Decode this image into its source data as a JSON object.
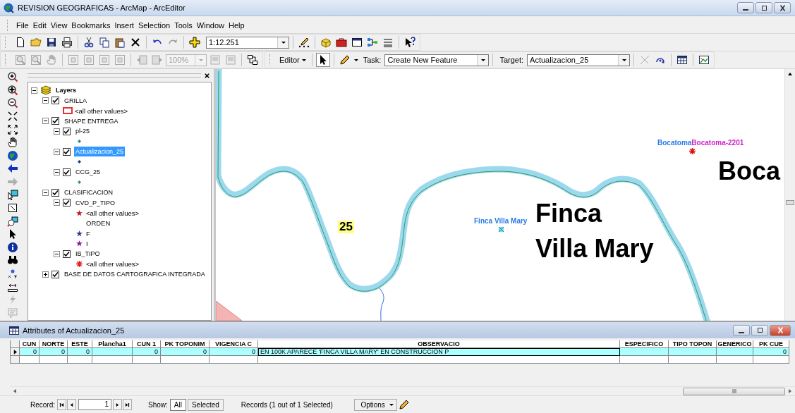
{
  "window": {
    "title": "REVISION GEOGRAFICAS - ArcMap - ArcEditor"
  },
  "menu": [
    "File",
    "Edit",
    "View",
    "Bookmarks",
    "Insert",
    "Selection",
    "Tools",
    "Window",
    "Help"
  ],
  "standard_toolbar": {
    "scale": "1:12.251"
  },
  "layout_toolbar": {
    "zoom": "100%",
    "zoom_disabled": true
  },
  "editor_toolbar": {
    "menu": "Editor",
    "task_label": "Task:",
    "task": "Create New Feature",
    "target_label": "Target:",
    "target": "Actualizacion_25"
  },
  "toc": {
    "root": {
      "label": "Layers",
      "expanded": true,
      "selected": false,
      "children": [
        {
          "label": "GRILLA",
          "checked": true,
          "expanded": true,
          "selected": false,
          "legend": [
            {
              "kind": "box",
              "color": "#e83030",
              "label": "<all other values>"
            }
          ]
        },
        {
          "label": "SHAPE ENTREGA",
          "checked": true,
          "expanded": true,
          "selected": false,
          "children": [
            {
              "label": "pl-25",
              "checked": true,
              "expanded": true,
              "selected": false,
              "legend": [
                {
                  "kind": "dot",
                  "color": "#1a8a8a"
                }
              ]
            },
            {
              "label": "Actualizacion_25",
              "checked": true,
              "expanded": true,
              "selected": true,
              "legend": [
                {
                  "kind": "dot",
                  "color": "#1a3a8a"
                }
              ]
            },
            {
              "label": "CCG_25",
              "checked": true,
              "expanded": true,
              "selected": false,
              "legend": [
                {
                  "kind": "dot",
                  "color": "#2a9a6a"
                }
              ]
            }
          ]
        },
        {
          "label": "CLASIFICACION",
          "checked": true,
          "expanded": true,
          "selected": false,
          "children": [
            {
              "label": "CVD_P_TIPO",
              "checked": true,
              "expanded": true,
              "selected": false,
              "legend": [
                {
                  "kind": "star",
                  "color": "#c01818",
                  "label": "<all other values>"
                },
                {
                  "kind": "heading",
                  "label": "ORDEN"
                },
                {
                  "kind": "star",
                  "color": "#2a3a8a",
                  "label": "F"
                },
                {
                  "kind": "star",
                  "color": "#8a1a9a",
                  "label": "I"
                }
              ]
            },
            {
              "label": "IB_TIPO",
              "checked": true,
              "expanded": true,
              "selected": false,
              "legend": [
                {
                  "kind": "burst",
                  "color": "#e81818",
                  "label": "<all other values>"
                }
              ]
            }
          ]
        },
        {
          "label": "BASE DE DATOS CARTOGRAFICA INTEGRADA",
          "checked": true,
          "expanded": false,
          "selected": false
        }
      ]
    }
  },
  "map": {
    "labels": [
      {
        "kind": "pair",
        "text": "Bocatoma",
        "text2": "Bocatoma-2201"
      },
      {
        "kind": "large",
        "lines": [
          "Boca"
        ]
      },
      {
        "kind": "halo",
        "text": "25"
      },
      {
        "kind": "point",
        "text": "Finca Villa Mary"
      },
      {
        "kind": "large",
        "lines": [
          "Finca",
          "Villa Mary"
        ]
      }
    ]
  },
  "attributes": {
    "title": "Attributes of Actualizacion_25",
    "columns": [
      "CUN",
      "NORTE",
      "ESTE",
      "Plancha1",
      "CUN 1",
      "PK TOPONIM",
      "VIGENCIA C",
      "OBSERVACIO",
      "ESPECIFICO",
      "TIPO TOPON",
      "GENERICO",
      "PK CUE"
    ],
    "rows": [
      {
        "selected": true,
        "cells": [
          "0",
          "0",
          "0",
          null,
          "0",
          "0",
          "0",
          "EN 100K APARECE 'FINCA VILLA MARY' EN CONSTRUCCION P",
          null,
          null,
          null,
          "0"
        ]
      }
    ]
  },
  "footer": {
    "record_label": "Record:",
    "record": "1",
    "show_label": "Show:",
    "show": [
      {
        "label": "All",
        "selected": true
      },
      {
        "label": "Selected",
        "selected": false
      }
    ],
    "status": "Records (1 out of 1 Selected)",
    "options": "Options"
  }
}
